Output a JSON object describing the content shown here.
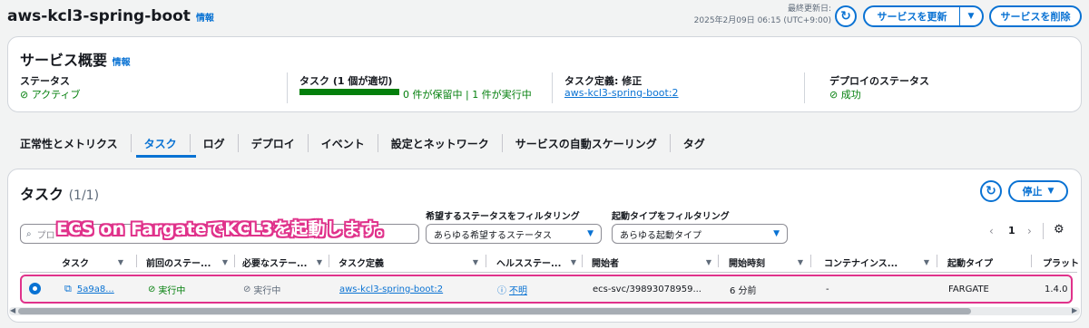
{
  "header": {
    "title": "aws-kcl3-spring-boot",
    "info": "情報",
    "last_updated_label": "最終更新日:",
    "last_updated_value": "2025年2月09日 06:15 (UTC+9:00)",
    "update_service_button": "サービスを更新",
    "delete_service_button": "サービスを削除"
  },
  "overview": {
    "title": "サービス概要",
    "info": "情報",
    "status_label": "ステータス",
    "status_value": "アクティブ",
    "tasks_label": "タスク (1 個が適切)",
    "tasks_progress": 1.0,
    "tasks_summary": "0 件が保留中 | 1 件が実行中",
    "taskdef_label": "タスク定義: 修正",
    "taskdef_value": "aws-kcl3-spring-boot:2",
    "deploy_label": "デプロイのステータス",
    "deploy_value": "成功"
  },
  "tabs": [
    "正常性とメトリクス",
    "タスク",
    "ログ",
    "デプロイ",
    "イベント",
    "設定とネットワーク",
    "サービスの自動スケーリング",
    "タグ"
  ],
  "tasks_panel": {
    "title": "タスク",
    "count": "(1/1)",
    "stop_button": "停止",
    "search_placeholder": "プロ",
    "desired_status_label": "希望するステータスをフィルタリング",
    "desired_status_value": "あらゆる希望するステータス",
    "launch_type_label": "起動タイプをフィルタリング",
    "launch_type_value": "あらゆる起動タイプ",
    "page_number": "1",
    "columns": [
      "タスク",
      "前回のステー...",
      "必要なステー...",
      "タスク定義",
      "ヘルスステー...",
      "開始者",
      "開始時刻",
      "コンテナインス...",
      "起動タイプ",
      "プラット"
    ],
    "row": {
      "task": "5a9a8...",
      "last_status": "実行中",
      "desired_status": "実行中",
      "task_definition": "aws-kcl3-spring-boot:2",
      "health_status": "不明",
      "started_by": "ecs-svc/39893078959...",
      "started_at": "6 分前",
      "container_instance": "-",
      "launch_type": "FARGATE",
      "platform": "1.4.0"
    }
  },
  "annotation": "ECS on FargateでKCL3を起動します。",
  "colors": {
    "accent": "#0972d3",
    "success": "#037f0c",
    "highlight": "#e0328b"
  }
}
